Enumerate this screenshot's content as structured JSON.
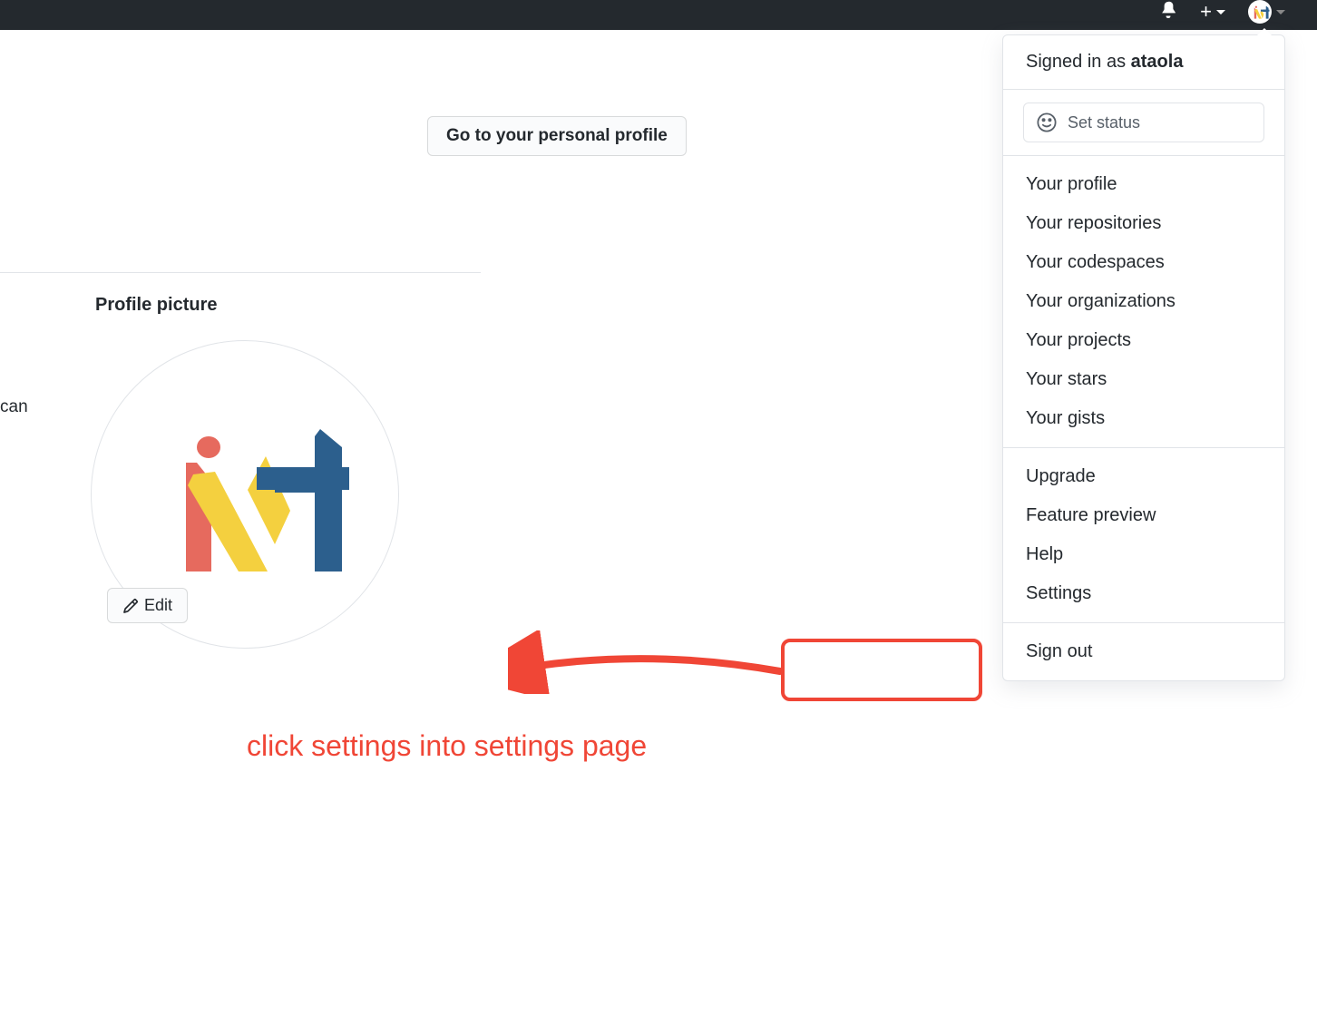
{
  "header": {
    "go_to_profile": "Go to your personal profile"
  },
  "profile": {
    "picture_label": "Profile picture",
    "edit_label": "Edit",
    "partial_text": "can"
  },
  "dropdown": {
    "signed_in_prefix": "Signed in as ",
    "username": "ataola",
    "set_status": "Set status",
    "group1": [
      "Your profile",
      "Your repositories",
      "Your codespaces",
      "Your organizations",
      "Your projects",
      "Your stars",
      "Your gists"
    ],
    "group2": [
      "Upgrade",
      "Feature preview",
      "Help",
      "Settings"
    ],
    "group3": [
      "Sign out"
    ]
  },
  "annotation": {
    "text": "click settings into settings page"
  }
}
